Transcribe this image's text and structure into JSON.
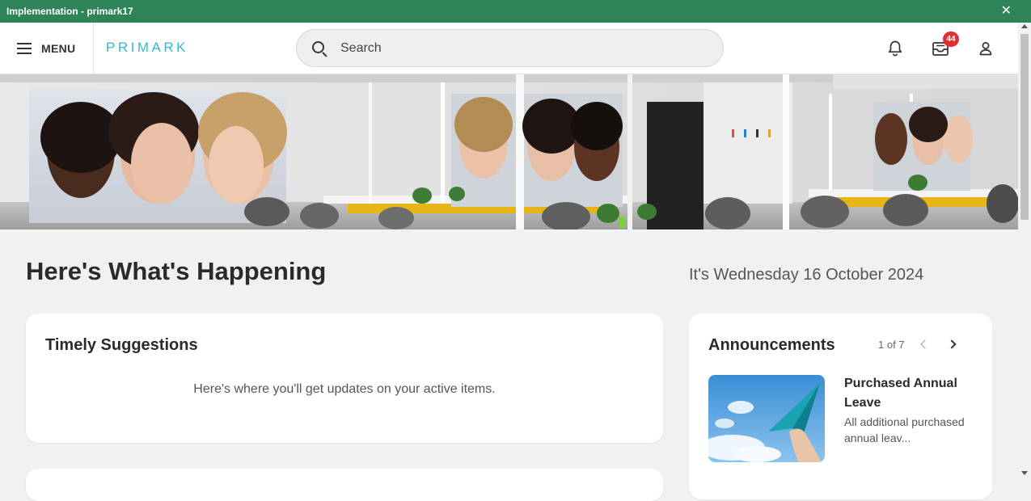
{
  "window": {
    "title": "Implementation - primark17",
    "close_glyph": "✕"
  },
  "header": {
    "menu_label": "MENU",
    "logo_text": "PRIMARK",
    "search_placeholder": "Search",
    "notifications_icon": "bell-icon",
    "inbox_icon": "inbox-icon",
    "inbox_badge": "44",
    "profile_icon": "user-icon"
  },
  "hero": {
    "image": "salon-banner"
  },
  "main": {
    "title": "Here's What's Happening",
    "date": "It's Wednesday 16 October 2024"
  },
  "timely": {
    "title": "Timely Suggestions",
    "empty_text": "Here's where you'll get updates on your active items."
  },
  "announcements": {
    "title": "Announcements",
    "pager": "1 of 7",
    "item_title": "Purchased Annual Leave",
    "item_desc": "All additional purchased annual leav..."
  },
  "colors": {
    "titlebar": "#2e8457",
    "logo": "#37b8cd",
    "badge": "#e02f2f",
    "background": "#f0f1f3"
  }
}
